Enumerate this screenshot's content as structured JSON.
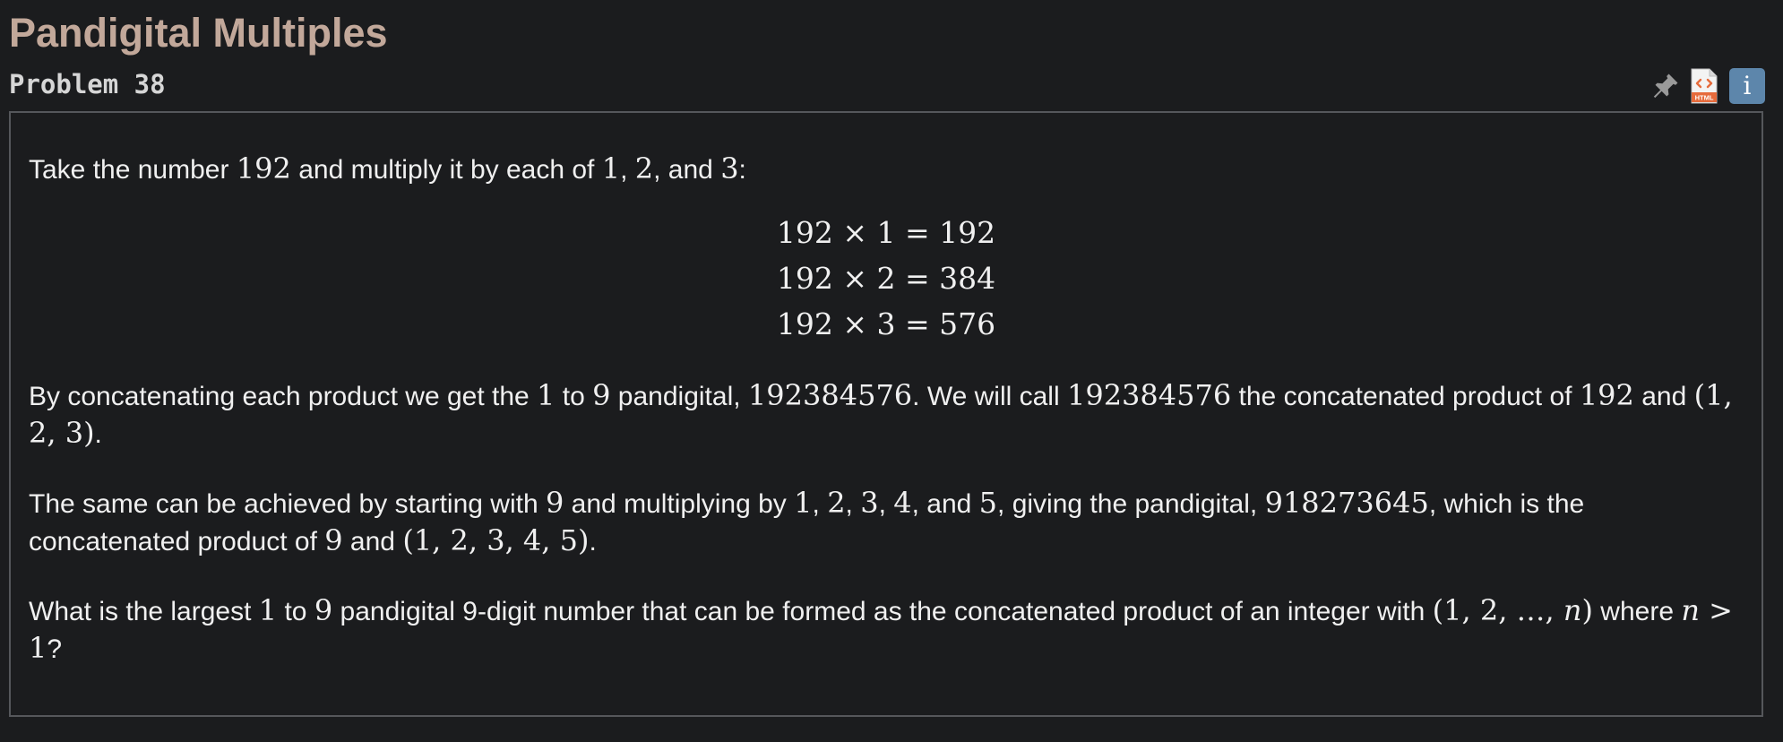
{
  "header": {
    "title": "Pandigital Multiples",
    "problem_label": "Problem 38"
  },
  "toolbar": {
    "icons": [
      "pin-icon",
      "html-icon",
      "info-icon"
    ],
    "html_icon_label": "HTML",
    "info_icon_label": "i"
  },
  "colors": {
    "background": "#1b1c1e",
    "title": "#c2a89a",
    "text": "#f0f0f0",
    "border": "#55575b",
    "info_button": "#5d86ab",
    "html_icon": "#e66b3c"
  },
  "problem": {
    "intro": {
      "t1": "Take the number ",
      "m1": "192",
      "t2": " and multiply it by each of ",
      "m2": "1",
      "t3": ", ",
      "m3": "2",
      "t4": ", and ",
      "m4": "3",
      "t5": ":"
    },
    "equations": [
      "192 × 1 = 192",
      "192 × 2 = 384",
      "192 × 3 = 576"
    ],
    "para1": {
      "t1": "By concatenating each product we get the ",
      "m1": "1",
      "t2": " to ",
      "m2": "9",
      "t3": " pandigital, ",
      "m3": "192384576",
      "t4": ". We will call ",
      "m4": "192384576",
      "t5": " the concatenated product of ",
      "m5": "192",
      "t6": " and ",
      "m6": "(1, 2, 3)",
      "t7": "."
    },
    "para2": {
      "t1": "The same can be achieved by starting with ",
      "m1": "9",
      "t2": " and multiplying by ",
      "m2": "1",
      "t3": ", ",
      "m3": "2",
      "t4": ", ",
      "m4": "3",
      "t5": ", ",
      "m5": "4",
      "t6": ", and ",
      "m6": "5",
      "t7": ", giving the pandigital, ",
      "m7": "918273645",
      "t8": ", which is the concatenated product of ",
      "m8": "9",
      "t9": " and ",
      "m9": "(1, 2, 3, 4, 5)",
      "t10": "."
    },
    "question": {
      "t1": "What is the largest ",
      "m1": "1",
      "t2": " to ",
      "m2": "9",
      "t3": " pandigital 9-digit number that can be formed as the concatenated product of an integer with ",
      "m3": "(1, 2, …, ",
      "m4": "n",
      "m5": ")",
      "t4": " where ",
      "m6": "n",
      "m7": " > 1",
      "t5": "?"
    }
  }
}
